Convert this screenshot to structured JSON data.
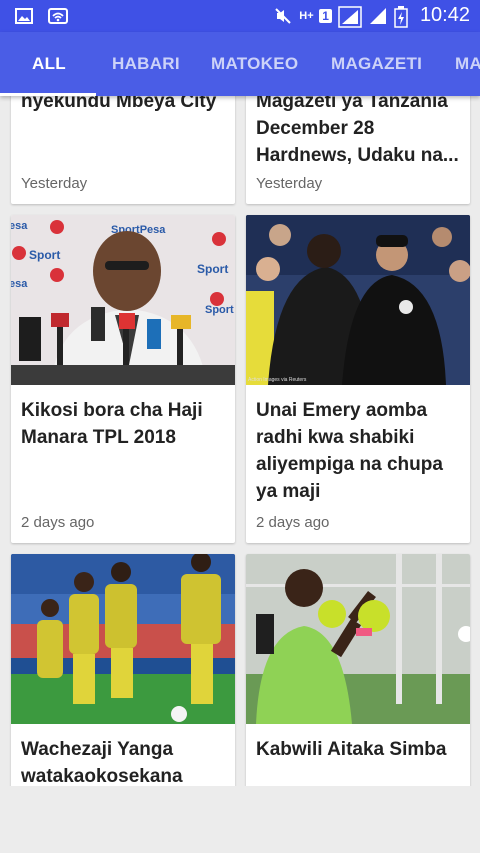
{
  "status_bar": {
    "time": "10:42",
    "network_label": "H+",
    "sim_label": "1",
    "icons": [
      "gallery-icon",
      "wifi-icon",
      "mute-icon",
      "signal-icon",
      "battery-icon"
    ]
  },
  "tabs": [
    {
      "label": "ALL",
      "active": true
    },
    {
      "label": "HABARI",
      "active": false
    },
    {
      "label": "MATOKEO",
      "active": false
    },
    {
      "label": "MAGAZETI",
      "active": false
    },
    {
      "label": "MA",
      "active": false
    }
  ],
  "colors": {
    "status_bar": "#3f51e6",
    "tab_bar": "#4a5de6",
    "background": "#ececec"
  },
  "cards": [
    {
      "title": "nyekundu Mbeya City",
      "time": "Yesterday",
      "has_image": false
    },
    {
      "title": "Magazeti ya Tanzania December 28 Hardnews, Udaku na...",
      "time": "Yesterday",
      "has_image": false
    },
    {
      "title": "Kikosi bora cha Haji Manara TPL 2018",
      "time": "2 days ago",
      "has_image": true
    },
    {
      "title": "Unai Emery aomba radhi kwa shabiki aliyempiga na chupa ya maji",
      "time": "2 days ago",
      "has_image": true
    },
    {
      "title": "Wachezaji Yanga watakaokosekana",
      "time": "",
      "has_image": true
    },
    {
      "title": "Kabwili Aitaka Simba",
      "time": "",
      "has_image": true
    }
  ],
  "image_texts": {
    "sponsor_1": "SportPesa",
    "sponsor_2": "Sport",
    "sponsor_3": "esa",
    "photo_credit": "Action Images via Reuters"
  }
}
